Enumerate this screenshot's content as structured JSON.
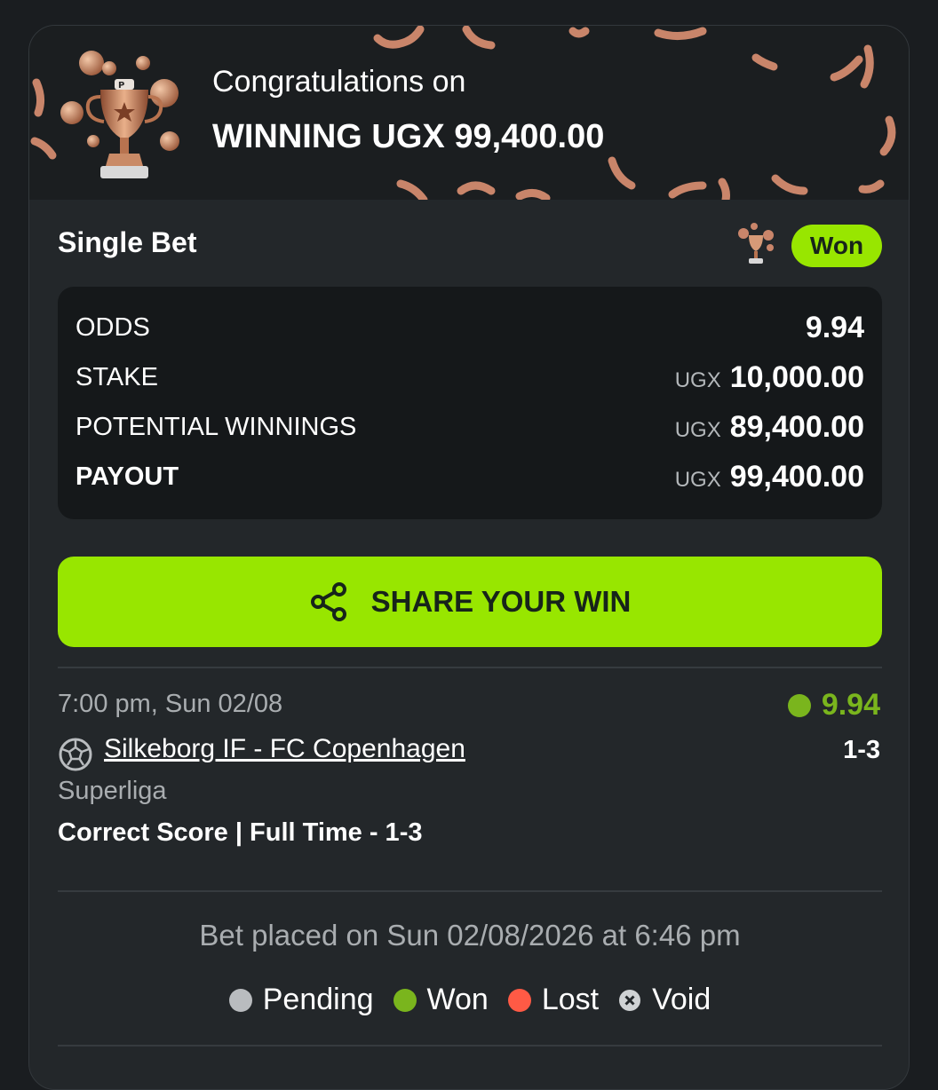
{
  "banner": {
    "line1": "Congratulations on",
    "line2": "WINNING UGX 99,400.00"
  },
  "bet": {
    "type": "Single Bet",
    "status": "Won"
  },
  "summary": {
    "rows": [
      {
        "label": "ODDS",
        "currency": "",
        "value": "9.94",
        "bold_label": false
      },
      {
        "label": "STAKE",
        "currency": "UGX",
        "value": "10,000.00",
        "bold_label": false
      },
      {
        "label": "POTENTIAL WINNINGS",
        "currency": "UGX",
        "value": "89,400.00",
        "bold_label": false
      },
      {
        "label": "PAYOUT",
        "currency": "UGX",
        "value": "99,400.00",
        "bold_label": true
      }
    ]
  },
  "share_button": {
    "label": "SHARE YOUR WIN",
    "icon": "share-icon"
  },
  "event": {
    "time": "7:00 pm, Sun 02/08",
    "odds": "9.94",
    "match": "Silkeborg IF - FC Copenhagen",
    "score": "1-3",
    "league": "Superliga",
    "market": "Correct Score | Full Time - 1-3"
  },
  "placed_on": "Bet placed on Sun 02/08/2026 at 6:46 pm",
  "legend": [
    {
      "label": "Pending",
      "color": "#b9bcbf",
      "icon": "dot"
    },
    {
      "label": "Won",
      "color": "#7ab51d",
      "icon": "dot"
    },
    {
      "label": "Lost",
      "color": "#ff5a45",
      "icon": "dot"
    },
    {
      "label": "Void",
      "color": "#cfd2d4",
      "icon": "x-circle-icon"
    }
  ],
  "colors": {
    "accent": "#98e600",
    "won": "#7ab51d",
    "lost": "#ff5a45",
    "card": "#23272a",
    "confetti": "#c9856a"
  }
}
